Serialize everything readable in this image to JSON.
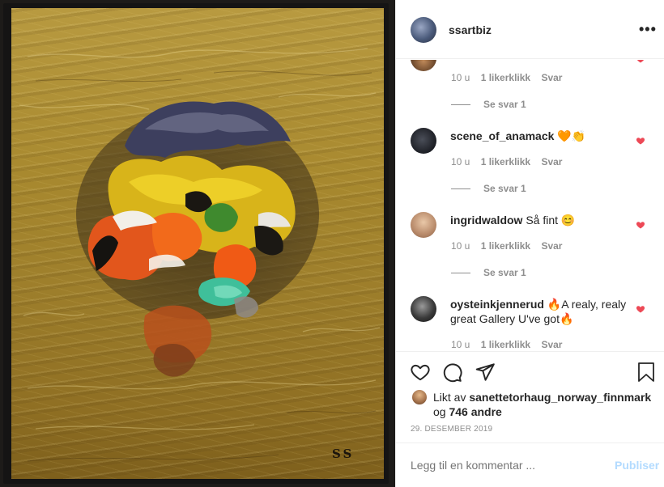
{
  "post": {
    "username": "ssartbiz",
    "more_icon": "more-horizontal-icon",
    "painting_signature": "SS"
  },
  "comments": [
    {
      "username": "",
      "text": "",
      "time": "10 u",
      "likes": "1 likerklikk",
      "reply": "Svar",
      "view_replies": "Se svar 1",
      "liked": true
    },
    {
      "username": "scene_of_anamack",
      "text": " 🧡👏",
      "time": "10 u",
      "likes": "1 likerklikk",
      "reply": "Svar",
      "view_replies": "Se svar 1",
      "liked": true
    },
    {
      "username": "ingridwaldow",
      "text": " Så fint 😊",
      "time": "10 u",
      "likes": "1 likerklikk",
      "reply": "Svar",
      "view_replies": "Se svar 1",
      "liked": true
    },
    {
      "username": "oysteinkjennerud",
      "text": " 🔥A realy, realy great Gallery U've got🔥",
      "time": "10 u",
      "likes": "1 likerklikk",
      "reply": "Svar",
      "liked": true
    }
  ],
  "likes": {
    "prefix": "Likt av ",
    "user": "sanettetorhaug_norway_finnmark",
    "middle": " og ",
    "count": "746 andre"
  },
  "date": "29. DESEMBER 2019",
  "compose": {
    "placeholder": "Legg til en kommentar ...",
    "post_label": "Publiser"
  },
  "colors": {
    "heart_red": "#ed4956",
    "link_blue_disabled": "#b3dbff",
    "muted_text": "#8e8e8e"
  }
}
